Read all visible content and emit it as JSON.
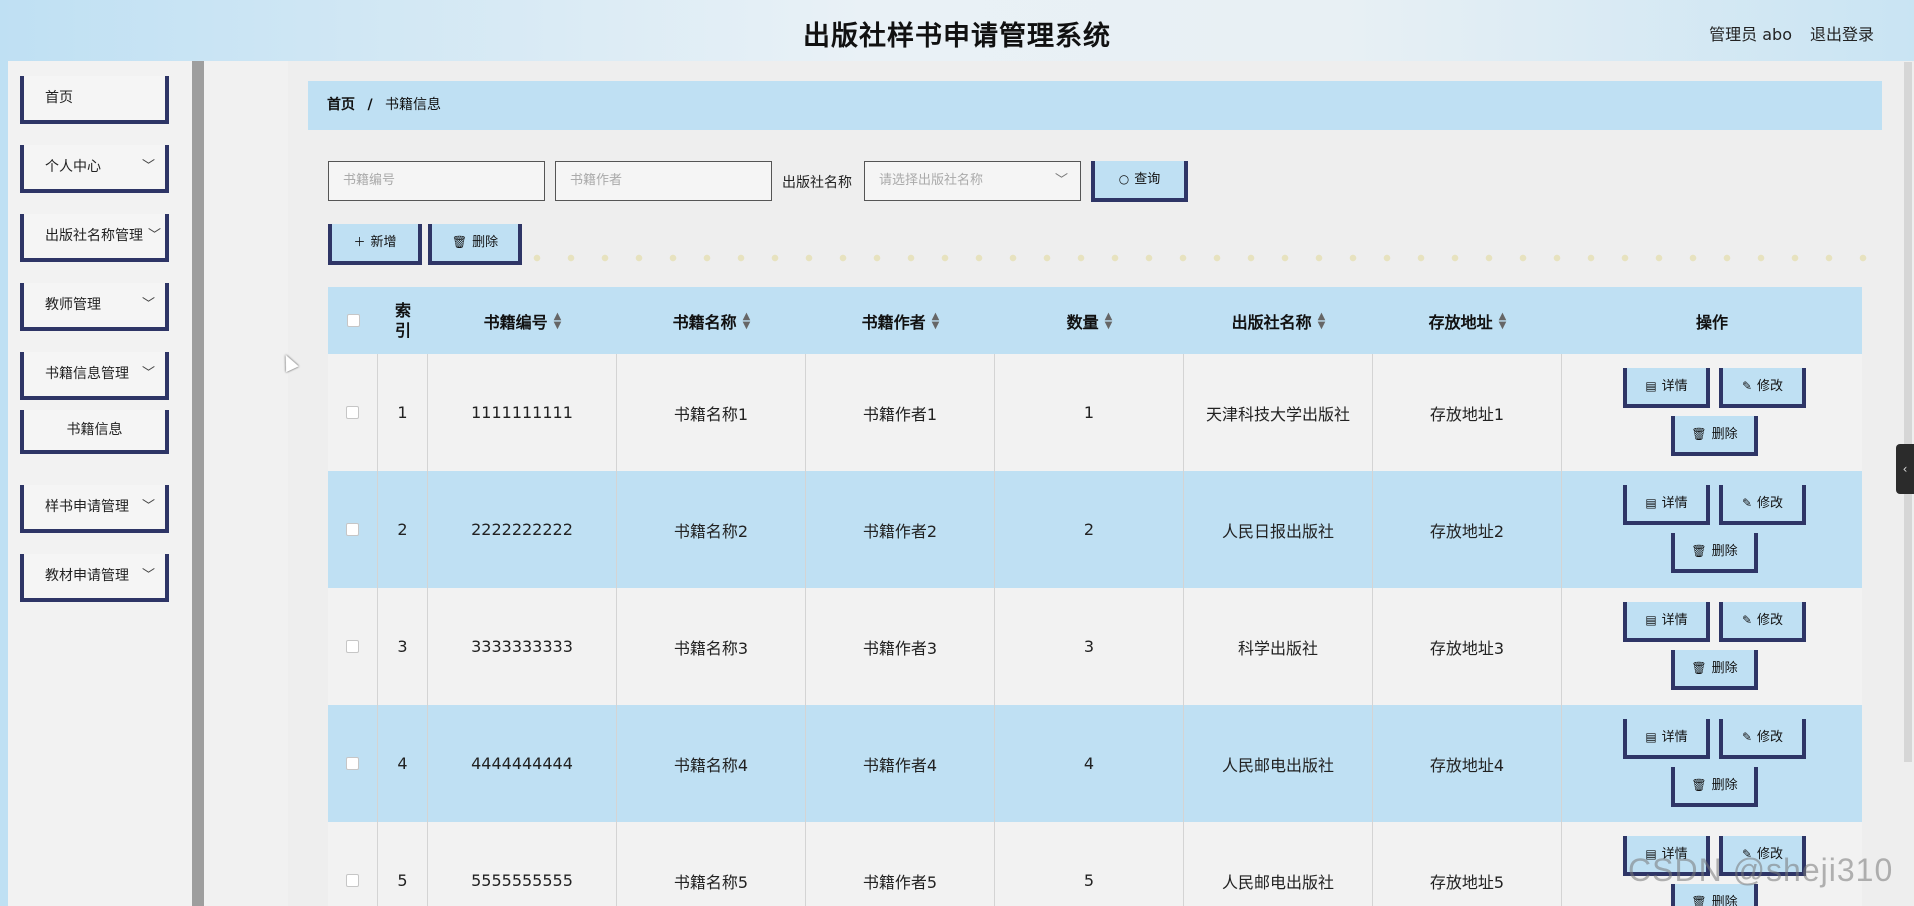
{
  "header": {
    "title": "出版社样书申请管理系统",
    "user": "管理员 abo",
    "logout": "退出登录"
  },
  "sidebar": {
    "items": [
      {
        "label": "首页",
        "chevron": ""
      },
      {
        "label": "个人中心",
        "chevron": "﹀"
      },
      {
        "label": "出版社名称管理",
        "chevron": "﹀"
      },
      {
        "label": "教师管理",
        "chevron": "﹀"
      },
      {
        "label": "书籍信息管理",
        "chevron": "﹀"
      },
      {
        "label": "样书申请管理",
        "chevron": "﹀"
      },
      {
        "label": "教材申请管理",
        "chevron": "﹀"
      }
    ],
    "sub_item": "书籍信息"
  },
  "breadcrumb": {
    "home": "首页",
    "sep": "/",
    "current": "书籍信息"
  },
  "search": {
    "book_no_placeholder": "书籍编号",
    "author_placeholder": "书籍作者",
    "publisher_label": "出版社名称",
    "publisher_placeholder": "请选择出版社名称",
    "query_label": "查询"
  },
  "toolbar": {
    "add_label": "新增",
    "delete_label": "删除"
  },
  "table": {
    "columns": [
      "索引",
      "书籍编号",
      "书籍名称",
      "书籍作者",
      "数量",
      "出版社名称",
      "存放地址",
      "操作"
    ],
    "index_col": [
      "索",
      "引"
    ],
    "rows": [
      {
        "index": "1",
        "no": "1111111111",
        "name": "书籍名称1",
        "author": "书籍作者1",
        "qty": "1",
        "publisher": "天津科技大学出版社",
        "address": "存放地址1"
      },
      {
        "index": "2",
        "no": "2222222222",
        "name": "书籍名称2",
        "author": "书籍作者2",
        "qty": "2",
        "publisher": "人民日报出版社",
        "address": "存放地址2"
      },
      {
        "index": "3",
        "no": "3333333333",
        "name": "书籍名称3",
        "author": "书籍作者3",
        "qty": "3",
        "publisher": "科学出版社",
        "address": "存放地址3"
      },
      {
        "index": "4",
        "no": "4444444444",
        "name": "书籍名称4",
        "author": "书籍作者4",
        "qty": "4",
        "publisher": "人民邮电出版社",
        "address": "存放地址4"
      },
      {
        "index": "5",
        "no": "5555555555",
        "name": "书籍名称5",
        "author": "书籍作者5",
        "qty": "5",
        "publisher": "人民邮电出版社",
        "address": "存放地址5"
      }
    ],
    "actions": {
      "detail": "详情",
      "edit": "修改",
      "delete": "删除"
    }
  },
  "watermark": "CSDN @sheji310",
  "colors": {
    "accent": "#bfe0f3",
    "border": "#2e3566",
    "sidebar_rail": "#9e9e9e"
  },
  "icons": {
    "search": "search-icon",
    "plus": "plus-icon",
    "trash": "trash-icon",
    "detail": "document-icon",
    "edit": "pencil-icon",
    "chevron": "chevron-down-icon",
    "collapse": "chevron-left-icon"
  }
}
